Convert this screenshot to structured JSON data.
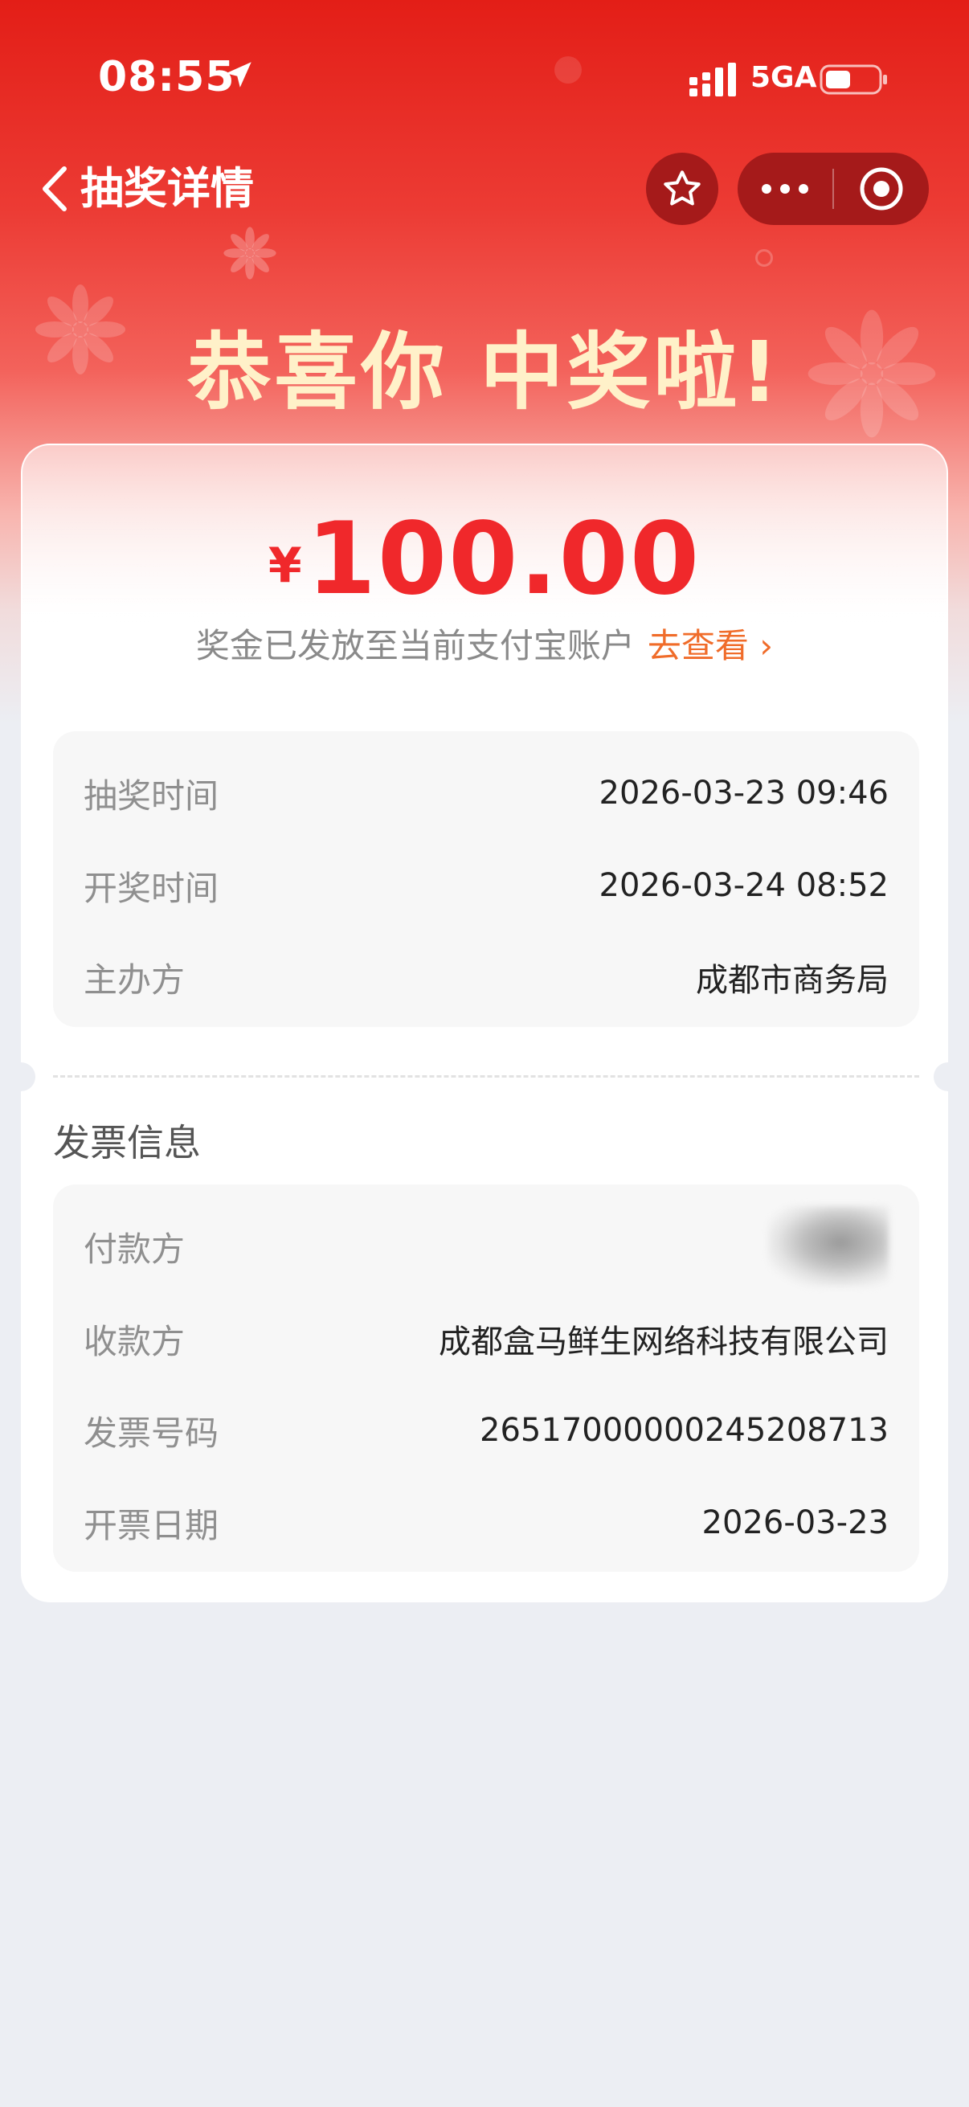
{
  "status_bar": {
    "time": "08:55",
    "network": "5GA"
  },
  "nav": {
    "title": "抽奖详情"
  },
  "headline": "恭喜你 中奖啦!",
  "prize": {
    "currency_symbol": "¥",
    "amount": "100.00",
    "notice": "奖金已发放至当前支付宝账户",
    "link_label": "去查看 ›"
  },
  "lottery_info": [
    {
      "label": "抽奖时间",
      "value": "2026-03-23 09:46"
    },
    {
      "label": "开奖时间",
      "value": "2026-03-24 08:52"
    },
    {
      "label": "主办方",
      "value": "成都市商务局"
    }
  ],
  "invoice": {
    "title": "发票信息",
    "payer_label": "付款方",
    "rows": [
      {
        "label": "收款方",
        "value": "成都盒马鲜生网络科技有限公司"
      },
      {
        "label": "发票号码",
        "value": "26517000000245208713"
      },
      {
        "label": "开票日期",
        "value": "2026-03-23"
      }
    ]
  },
  "colors": {
    "header_red": "#E31E17",
    "amount_red": "#F0282B",
    "link_orange": "#F06C2A",
    "headline_cream": "#FFF1C9",
    "page_bg": "#ECEEF3"
  }
}
